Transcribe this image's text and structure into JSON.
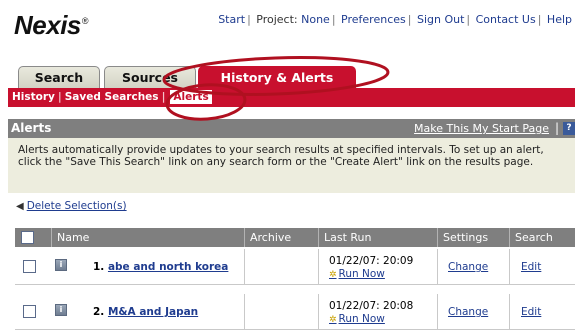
{
  "brand": {
    "name": "Nexis",
    "mark": "®"
  },
  "toplinks": {
    "start": "Start",
    "project_label": "Project:",
    "project_value": "None",
    "preferences": "Preferences",
    "signout": "Sign Out",
    "contact": "Contact Us",
    "help": "Help"
  },
  "tabs": {
    "search": "Search",
    "sources": "Sources",
    "history_alerts": "History & Alerts"
  },
  "subnav": {
    "history": "History",
    "saved_searches": "Saved Searches",
    "alerts": "Alerts"
  },
  "section": {
    "title": "Alerts",
    "make_start": "Make This My Start Page",
    "divider": "|",
    "help_icon": "?"
  },
  "description": "Alerts automatically provide updates to your search results at specified intervals. To set up an alert, click the \"Save This Search\" link on any search form or the \"Create Alert\" link on the results page.",
  "delete_selection": "Delete Selection(s)",
  "table": {
    "headers": {
      "name": "Name",
      "archive": "Archive",
      "last_run": "Last Run",
      "settings": "Settings",
      "search": "Search"
    },
    "rows": [
      {
        "index": "1.",
        "name": "abe and north korea",
        "archive": "",
        "last_run": "01/22/07: 20:09",
        "run_now": "Run Now",
        "settings": "Change",
        "search": "Edit"
      },
      {
        "index": "2.",
        "name": "M&A and Japan",
        "archive": "",
        "last_run": "01/22/07: 20:08",
        "run_now": "Run Now",
        "settings": "Change",
        "search": "Edit"
      }
    ]
  },
  "colors": {
    "accent_red": "#c8102e",
    "header_gray": "#7f7f7f",
    "desc_bg": "#ededde",
    "link_blue": "#1f3c8f",
    "annotation": "#b01020"
  }
}
